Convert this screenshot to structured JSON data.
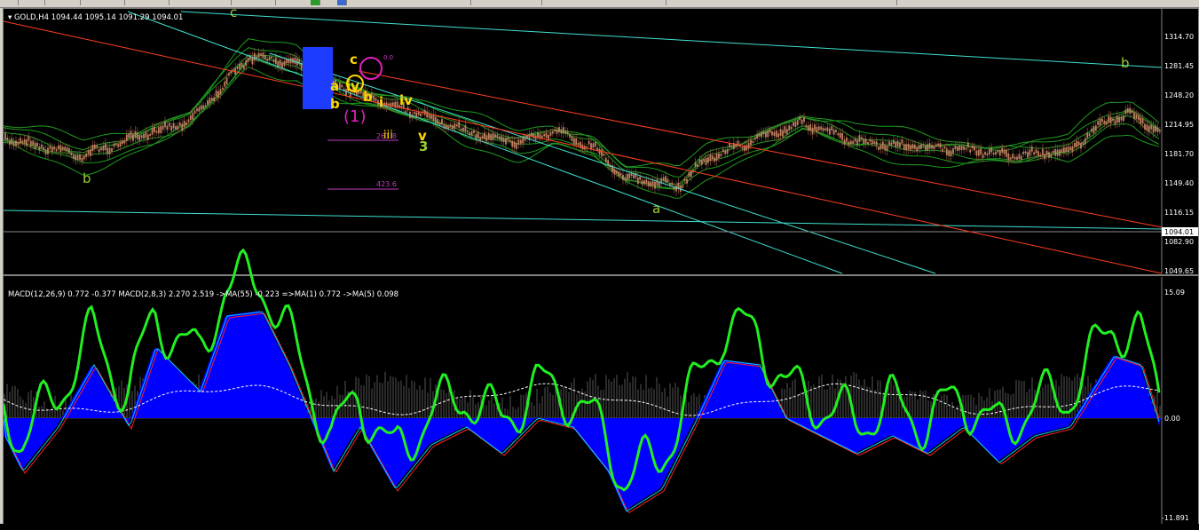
{
  "chart": {
    "symbol_label": "GOLD,H4",
    "ohlc": "1094.44 1095.14 1091.29 1094.01",
    "current_price": "1094.01",
    "price_ticks": [
      "1314.70",
      "1281.45",
      "1248.20",
      "1214.95",
      "1181.70",
      "1149.40",
      "1116.15",
      "1082.90",
      "1049.65"
    ],
    "wave_labels": {
      "b_left": "b",
      "c_top": "c",
      "a_mid": "a",
      "b_right": "b",
      "iii": "iii",
      "iv": "iv",
      "v": "v",
      "three": "3",
      "cluster_a": "a",
      "cluster_b": "b",
      "cluster_b2": "b",
      "cluster_one": "(1)",
      "cluster_iv": "iv",
      "cluster_c": "c",
      "cluster_i": "i"
    },
    "fib_labels": {
      "fib_top": "0.0",
      "fib_261": "261.8",
      "fib_423": "423.6"
    }
  },
  "indicator": {
    "label": "MACD(12,26,9) 0.772 -0.377  MACD(2,8,3) 2.270 2.519  ->MA(55) -0.223  =>MA(1) 0.772  ->MA(5) 0.098",
    "ticks": [
      "15.09",
      "0.00",
      "-11.891"
    ]
  },
  "colors": {
    "background": "#000000",
    "grid_text": "#ffffff",
    "channel_cyan": "#40e0d0",
    "channel_red": "#ff4020",
    "envelope_green": "#1f9a1f",
    "candle_body": "#c08060",
    "wave_label": "#9acd32",
    "wave_label_yellow": "#ffd700",
    "fib_magenta": "#c040c0",
    "box_blue": "#1e3cff",
    "macd_blue": "#0000ff",
    "signal_green": "#22ee22",
    "line_red": "#ff2020",
    "line_cyan": "#00c8ff",
    "ma_white": "#ffffff"
  }
}
